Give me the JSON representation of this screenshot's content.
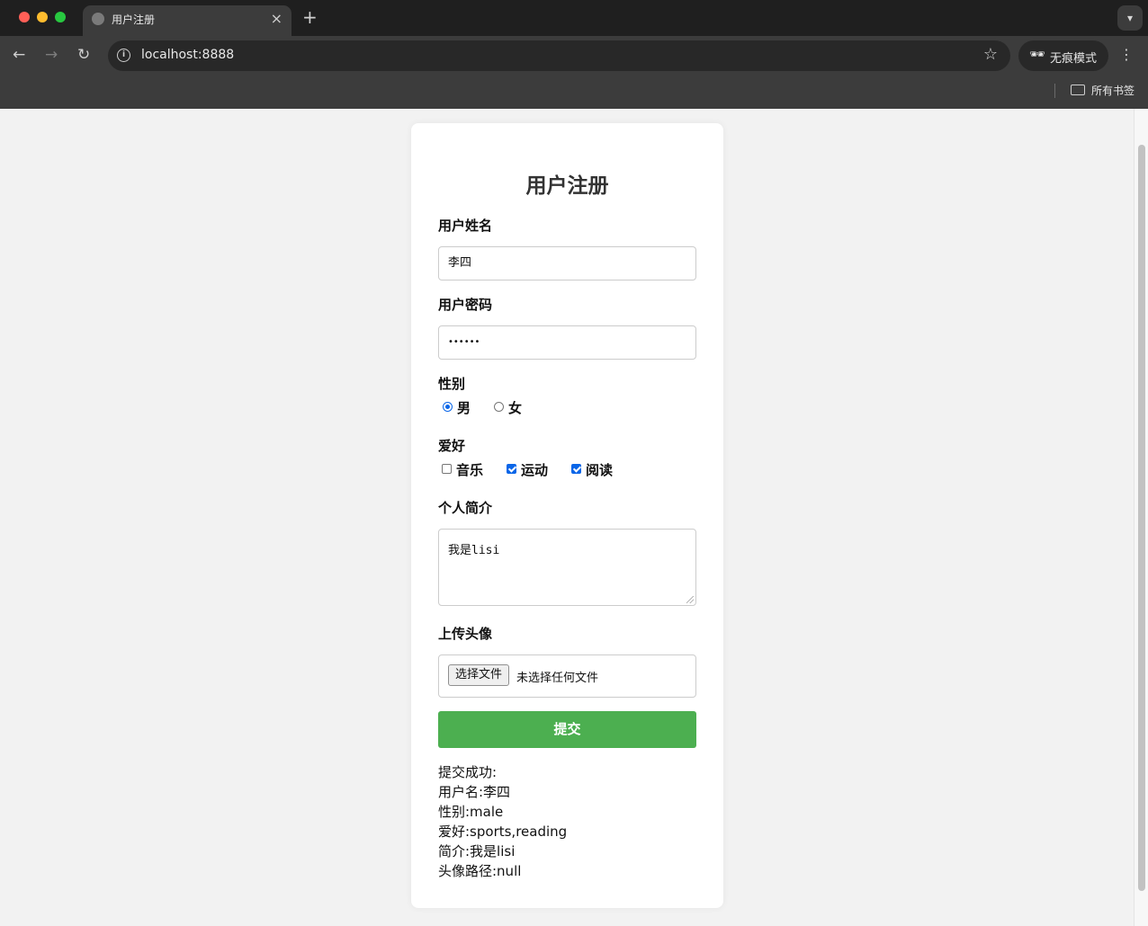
{
  "browser": {
    "tab_title": "用户注册",
    "url": "localhost:8888",
    "incognito_label": "无痕模式",
    "bookmarks_label": "所有书签"
  },
  "form": {
    "title": "用户注册",
    "username": {
      "label": "用户姓名",
      "value": "李四"
    },
    "password": {
      "label": "用户密码",
      "value": "••••••"
    },
    "gender": {
      "label": "性别",
      "options": [
        {
          "label": "男",
          "checked": true
        },
        {
          "label": "女",
          "checked": false
        }
      ]
    },
    "hobbies": {
      "label": "爱好",
      "options": [
        {
          "label": "音乐",
          "checked": false
        },
        {
          "label": "运动",
          "checked": true
        },
        {
          "label": "阅读",
          "checked": true
        }
      ]
    },
    "bio": {
      "label": "个人简介",
      "value": "我是lisi"
    },
    "avatar": {
      "label": "上传头像",
      "button": "选择文件",
      "status": "未选择任何文件"
    },
    "submit": "提交"
  },
  "result": {
    "line1": "提交成功:",
    "line2": "用户名:李四",
    "line3": "性别:male",
    "line4": "爱好:sports,reading",
    "line5": "简介:我是lisi",
    "line6": "头像路径:null"
  },
  "colors": {
    "accent": "#4caf50",
    "checkbox": "#0a66e8"
  }
}
